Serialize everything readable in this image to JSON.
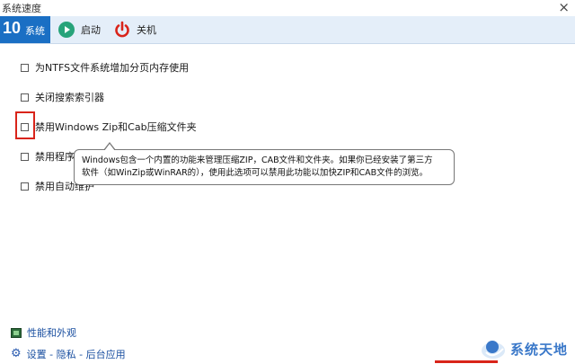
{
  "window": {
    "title": "系统速度",
    "close_glyph": "×"
  },
  "toolbar": {
    "system_number": "10",
    "system_label": "系统",
    "start_label": "启动",
    "shutdown_label": "关机"
  },
  "options": [
    {
      "label": "为NTFS文件系统增加分页内存使用",
      "checked": false
    },
    {
      "label": "关闭搜索索引器",
      "checked": false
    },
    {
      "label": "禁用Windows Zip和Cab压缩文件夹",
      "checked": false,
      "highlighted": true
    },
    {
      "label": "禁用程序",
      "checked": false
    },
    {
      "label": "禁用自动维护",
      "checked": false
    }
  ],
  "tooltip": {
    "line1": "Windows包含一个内置的功能来管理压缩ZIP，CAB文件和文件夹。如果你已经安装了第三方",
    "line2": "软件（如WinZip或WinRAR的），使用此选项可以禁用此功能以加快ZIP和CAB文件的浏览。"
  },
  "links": {
    "performance": "性能和外观",
    "settings": "设置 - 隐私 - 后台应用"
  },
  "watermark": {
    "text": "系统天地"
  },
  "colors": {
    "accent": "#1a6fc4",
    "highlight": "#d9241a",
    "start_green": "#27a37a",
    "power_red": "#d9241a"
  },
  "icons": {
    "start": "play-circle-icon",
    "shutdown": "power-icon",
    "performance": "monitor-icon",
    "settings": "gear-icon"
  }
}
